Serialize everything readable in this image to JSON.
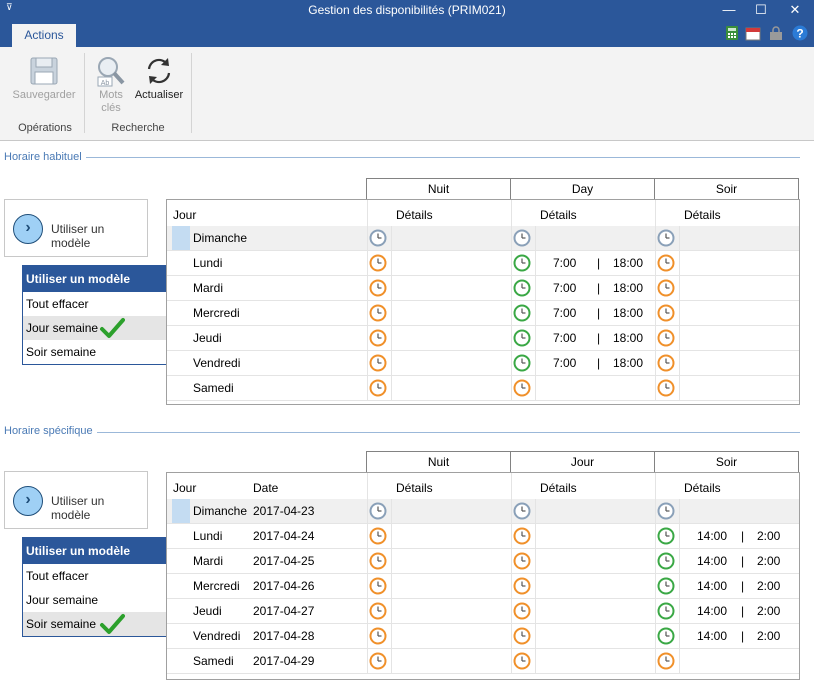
{
  "window": {
    "title": "Gestion des disponibilités (PRIM021)",
    "qa_symbol": "⊽",
    "min": "—",
    "max": "☐",
    "close": "✕"
  },
  "ribbon": {
    "tab": "Actions",
    "save": "Sauvegarder",
    "keywords_1": "Mots",
    "keywords_2": "clés",
    "refresh": "Actualiser",
    "group_ops": "Opérations",
    "group_search": "Recherche"
  },
  "habituel": {
    "section_title": "Horaire habituel",
    "model_button": "Utiliser un modèle",
    "menu": {
      "header": "Utiliser un modèle",
      "items": [
        "Tout effacer",
        "Jour semaine",
        "Soir semaine"
      ],
      "selected": 1
    },
    "periods": [
      "Nuit",
      "Day",
      "Soir"
    ],
    "col_day": "Jour",
    "col_details": "Détails",
    "rows": [
      {
        "day": "Dimanche",
        "n": "grey",
        "d": "grey",
        "s": "grey",
        "d_start": "",
        "d_end": "",
        "sep": ""
      },
      {
        "day": "Lundi",
        "n": "orange",
        "d": "green",
        "s": "orange",
        "d_start": "7:00",
        "d_end": "18:00",
        "sep": "|"
      },
      {
        "day": "Mardi",
        "n": "orange",
        "d": "green",
        "s": "orange",
        "d_start": "7:00",
        "d_end": "18:00",
        "sep": "|"
      },
      {
        "day": "Mercredi",
        "n": "orange",
        "d": "green",
        "s": "orange",
        "d_start": "7:00",
        "d_end": "18:00",
        "sep": "|"
      },
      {
        "day": "Jeudi",
        "n": "orange",
        "d": "green",
        "s": "orange",
        "d_start": "7:00",
        "d_end": "18:00",
        "sep": "|"
      },
      {
        "day": "Vendredi",
        "n": "orange",
        "d": "green",
        "s": "orange",
        "d_start": "7:00",
        "d_end": "18:00",
        "sep": "|"
      },
      {
        "day": "Samedi",
        "n": "orange",
        "d": "orange",
        "s": "orange",
        "d_start": "",
        "d_end": "",
        "sep": ""
      }
    ]
  },
  "specifique": {
    "section_title": "Horaire spécifique",
    "model_button": "Utiliser un modèle",
    "menu": {
      "header": "Utiliser un modèle",
      "items": [
        "Tout effacer",
        "Jour semaine",
        "Soir semaine"
      ],
      "selected": 2
    },
    "periods": [
      "Nuit",
      "Jour",
      "Soir"
    ],
    "col_day": "Jour",
    "col_date": "Date",
    "col_details": "Détails",
    "rows": [
      {
        "day": "Dimanche",
        "date": "2017-04-23",
        "n": "grey",
        "d": "grey",
        "s": "grey",
        "s_start": "",
        "s_end": "",
        "sep": ""
      },
      {
        "day": "Lundi",
        "date": "2017-04-24",
        "n": "orange",
        "d": "orange",
        "s": "green",
        "s_start": "14:00",
        "s_end": "2:00",
        "sep": "|"
      },
      {
        "day": "Mardi",
        "date": "2017-04-25",
        "n": "orange",
        "d": "orange",
        "s": "green",
        "s_start": "14:00",
        "s_end": "2:00",
        "sep": "|"
      },
      {
        "day": "Mercredi",
        "date": "2017-04-26",
        "n": "orange",
        "d": "orange",
        "s": "green",
        "s_start": "14:00",
        "s_end": "2:00",
        "sep": "|"
      },
      {
        "day": "Jeudi",
        "date": "2017-04-27",
        "n": "orange",
        "d": "orange",
        "s": "green",
        "s_start": "14:00",
        "s_end": "2:00",
        "sep": "|"
      },
      {
        "day": "Vendredi",
        "date": "2017-04-28",
        "n": "orange",
        "d": "orange",
        "s": "green",
        "s_start": "14:00",
        "s_end": "2:00",
        "sep": "|"
      },
      {
        "day": "Samedi",
        "date": "2017-04-29",
        "n": "orange",
        "d": "orange",
        "s": "orange",
        "s_start": "",
        "s_end": "",
        "sep": ""
      }
    ]
  },
  "colors": {
    "accent": "#2b579a",
    "grey": "#8aa0b8",
    "orange": "#f0902a",
    "green": "#3aa845",
    "check": "#2ca02c"
  },
  "icons": {
    "clock_states": "clock-icon"
  }
}
